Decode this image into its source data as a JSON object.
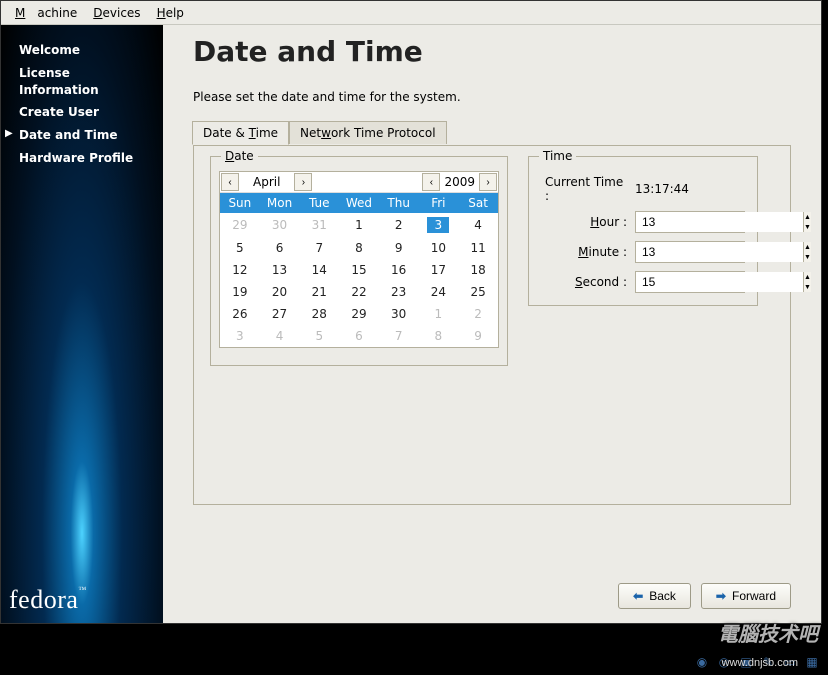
{
  "menubar": {
    "machine": "Machine",
    "devices": "Devices",
    "help": "Help"
  },
  "sidebar": {
    "items": [
      {
        "label": "Welcome"
      },
      {
        "label": "License Information"
      },
      {
        "label": "Create User"
      },
      {
        "label": "Date and Time"
      },
      {
        "label": "Hardware Profile"
      }
    ],
    "logo": "fedora",
    "logo_tm": "™"
  },
  "page": {
    "title": "Date and Time",
    "instruction": "Please set the date and time for the system."
  },
  "tabs": {
    "datetime": "Date & Time",
    "ntp": "Network Time Protocol"
  },
  "date": {
    "legend": "Date",
    "month": "April",
    "year": "2009",
    "dow": [
      "Sun",
      "Mon",
      "Tue",
      "Wed",
      "Thu",
      "Fri",
      "Sat"
    ],
    "weeks": [
      [
        {
          "d": "29",
          "o": true
        },
        {
          "d": "30",
          "o": true
        },
        {
          "d": "31",
          "o": true
        },
        {
          "d": "1"
        },
        {
          "d": "2"
        },
        {
          "d": "3",
          "sel": true
        },
        {
          "d": "4"
        }
      ],
      [
        {
          "d": "5"
        },
        {
          "d": "6"
        },
        {
          "d": "7"
        },
        {
          "d": "8"
        },
        {
          "d": "9"
        },
        {
          "d": "10"
        },
        {
          "d": "11"
        }
      ],
      [
        {
          "d": "12"
        },
        {
          "d": "13"
        },
        {
          "d": "14"
        },
        {
          "d": "15"
        },
        {
          "d": "16"
        },
        {
          "d": "17"
        },
        {
          "d": "18"
        }
      ],
      [
        {
          "d": "19"
        },
        {
          "d": "20"
        },
        {
          "d": "21"
        },
        {
          "d": "22"
        },
        {
          "d": "23"
        },
        {
          "d": "24"
        },
        {
          "d": "25"
        }
      ],
      [
        {
          "d": "26"
        },
        {
          "d": "27"
        },
        {
          "d": "28"
        },
        {
          "d": "29"
        },
        {
          "d": "30"
        },
        {
          "d": "1",
          "o": true
        },
        {
          "d": "2",
          "o": true
        }
      ],
      [
        {
          "d": "3",
          "o": true
        },
        {
          "d": "4",
          "o": true
        },
        {
          "d": "5",
          "o": true
        },
        {
          "d": "6",
          "o": true
        },
        {
          "d": "7",
          "o": true
        },
        {
          "d": "8",
          "o": true
        },
        {
          "d": "9",
          "o": true
        }
      ]
    ]
  },
  "time": {
    "legend": "Time",
    "current_label": "Current Time :",
    "current_value": "13:17:44",
    "hour_label": "Hour :",
    "hour_value": "13",
    "minute_label": "Minute :",
    "minute_value": "13",
    "second_label": "Second :",
    "second_value": "15"
  },
  "buttons": {
    "back": "Back",
    "forward": "Forward"
  },
  "watermark": {
    "logo": "電腦技术吧",
    "url": "www.dnjsb.com"
  }
}
